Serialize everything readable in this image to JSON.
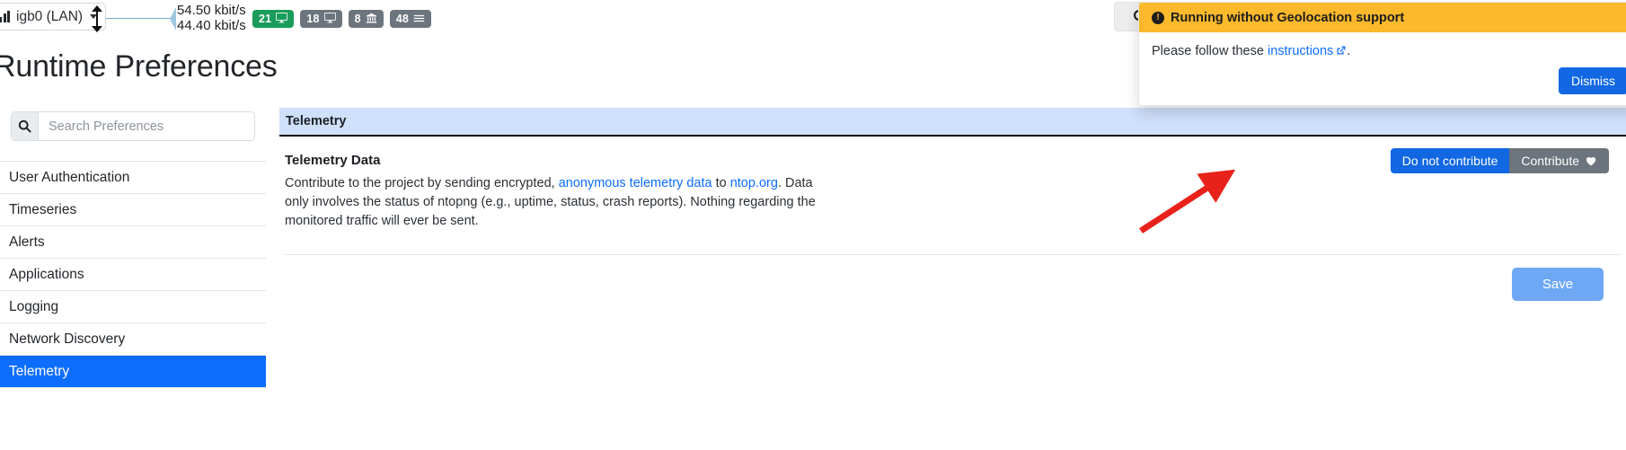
{
  "navbar": {
    "interface_label": "igb0 (LAN)",
    "interface_icon": "bar-chart-icon",
    "updown_icon": "up-down-arrow-icon",
    "rate_down": "54.50 kbit/s",
    "rate_up": "44.40 kbit/s",
    "search_icon": "search-icon",
    "badges": [
      {
        "count": "21",
        "icon": "display-icon",
        "color": "#1a9c5b"
      },
      {
        "count": "18",
        "icon": "display-icon",
        "color": "#6c757d"
      },
      {
        "count": "8",
        "icon": "bank-icon",
        "color": "#6c757d"
      },
      {
        "count": "48",
        "icon": "list-icon",
        "color": "#6c757d"
      }
    ]
  },
  "toast": {
    "icon": "exclamation-circle-icon",
    "title": "Running without Geolocation support",
    "body_prefix": "Please follow these ",
    "body_link": "instructions",
    "link_icon": "external-link-icon",
    "body_suffix": ".",
    "dismiss_label": "Dismiss",
    "header_color": "#fcb92c",
    "dismiss_color": "#1268e3"
  },
  "page": {
    "title": "Runtime Preferences"
  },
  "sidebar": {
    "search_placeholder": "Search Preferences",
    "search_value": "",
    "search_icon": "search-icon",
    "items": [
      {
        "label": "User Authentication",
        "active": false
      },
      {
        "label": "Timeseries",
        "active": false
      },
      {
        "label": "Alerts",
        "active": false
      },
      {
        "label": "Applications",
        "active": false
      },
      {
        "label": "Logging",
        "active": false
      },
      {
        "label": "Network Discovery",
        "active": false
      },
      {
        "label": "Telemetry",
        "active": true
      }
    ]
  },
  "panel": {
    "header": "Telemetry",
    "header_bg": "#cfe0fb",
    "row": {
      "title": "Telemetry Data",
      "desc_part1": "Contribute to the project by sending encrypted, ",
      "desc_link1": "anonymous telemetry data",
      "desc_part2": " to ",
      "desc_link2": "ntop.org",
      "desc_part3": ". Data only involves the status of ntopng (e.g., uptime, status, crash reports). Nothing regarding the monitored traffic will ever be sent.",
      "toggle_on_label": "Do not contribute",
      "toggle_off_label": "Contribute",
      "toggle_off_icon": "heart-icon",
      "toggle_on_color": "#1268e3",
      "toggle_off_color": "#6c757d"
    },
    "save_label": "Save",
    "save_color": "#6ea8f5"
  },
  "annotation": {
    "arrow_color": "#e8221a",
    "arrow_icon": "red-arrow-pointer"
  }
}
